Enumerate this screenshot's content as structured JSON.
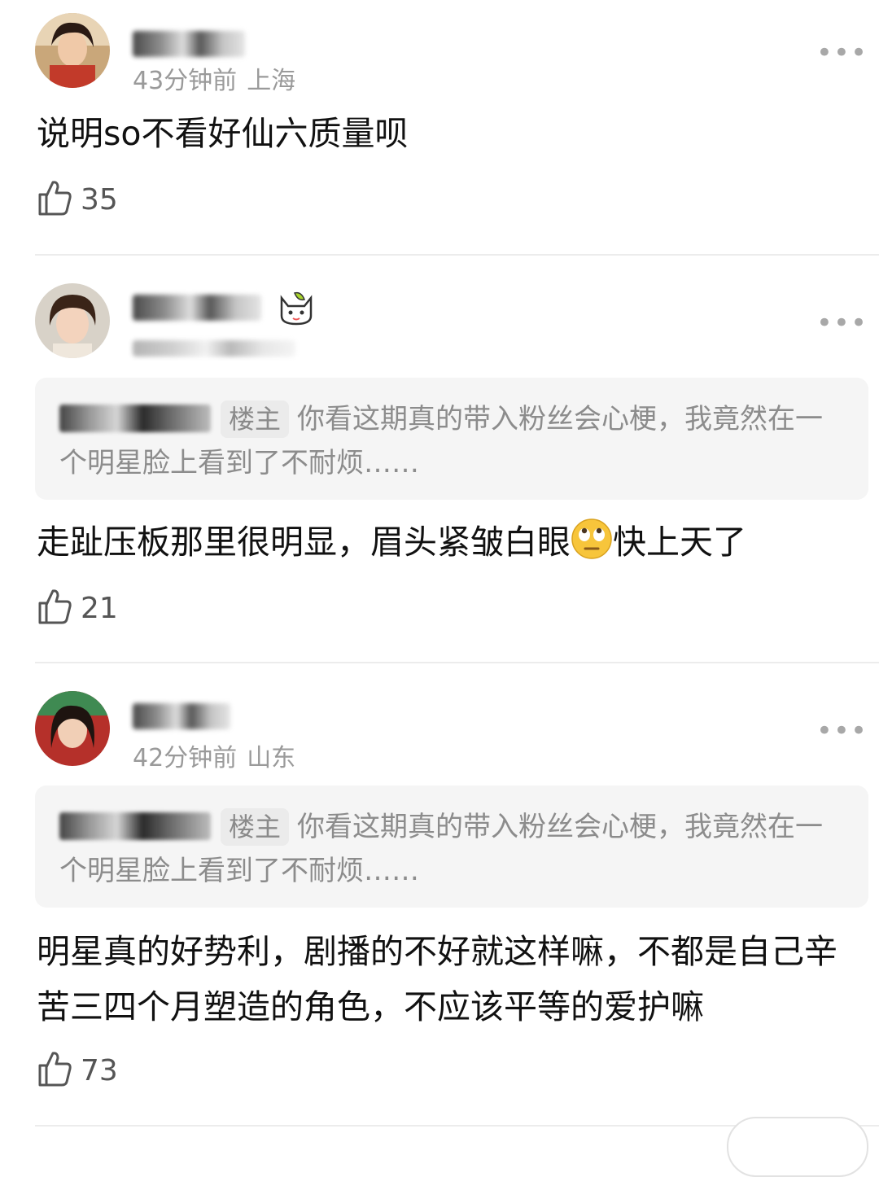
{
  "comments": [
    {
      "time": "43分钟前",
      "location": "上海",
      "text": "说明so不看好仙六质量呗",
      "likes": "35",
      "more_label": "•••"
    },
    {
      "text": "走趾压板那里很明显，眉头紧皱白眼",
      "text_after_emoji": "快上天了",
      "quote_tag": "楼主",
      "quote_text": "你看这期真的带入粉丝会心梗，我竟然在一个明星脸上看到了不耐烦……",
      "likes": "21",
      "more_label": "•••"
    },
    {
      "time": "42分钟前",
      "location": "山东",
      "quote_tag": "楼主",
      "quote_text": "你看这期真的带入粉丝会心梗，我竟然在一个明星脸上看到了不耐烦……",
      "text": "明星真的好势利，剧播的不好就这样嘛，不都是自己辛苦三四个月塑造的角色，不应该平等的爱护嘛",
      "likes": "73",
      "more_label": "•••"
    }
  ],
  "icons": {
    "like": "thumbs-up-icon",
    "more": "more-dots-icon",
    "emoji": "eye-roll-emoji"
  },
  "colors": {
    "meta_text": "#9a9a9a",
    "quote_bg": "#f5f5f5",
    "divider": "#ececec"
  }
}
